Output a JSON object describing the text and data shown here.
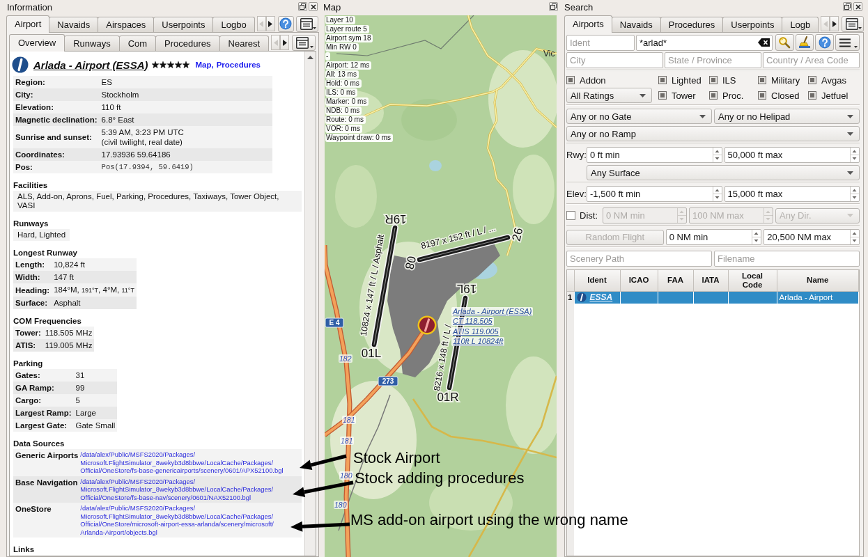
{
  "information": {
    "title": "Information",
    "tabs": [
      {
        "label": "Airport",
        "selected": true
      },
      {
        "label": "Navaids",
        "selected": false
      },
      {
        "label": "Airspaces",
        "selected": false
      },
      {
        "label": "Userpoints",
        "selected": false
      },
      {
        "label": "Logbo",
        "selected": false
      }
    ],
    "tab_scroll": [
      {
        "disabled": true
      },
      {
        "disabled": false
      }
    ],
    "subtabs": [
      {
        "label": "Overview",
        "selected": true
      },
      {
        "label": "Runways",
        "selected": false
      },
      {
        "label": "Com",
        "selected": false
      },
      {
        "label": "Procedures",
        "selected": false
      },
      {
        "label": "Nearest",
        "selected": false
      }
    ],
    "subtab_scroll": [
      {
        "disabled": true
      },
      {
        "disabled": false
      }
    ],
    "airport": {
      "name": "Arlada - Airport (ESSA)",
      "stars": 5,
      "links": [
        "Map",
        "Procedures"
      ],
      "link_separator": ","
    },
    "overview": [
      {
        "label": "Region:",
        "value": "ES",
        "kind": "text"
      },
      {
        "label": "City:",
        "value": "Stockholm",
        "kind": "text"
      },
      {
        "label": "Elevation:",
        "value": "110 ft",
        "kind": "text"
      },
      {
        "label": "Magnetic declination:",
        "value": "6.8° East",
        "kind": "text"
      },
      {
        "label": "Sunrise and sunset:",
        "value": "5:39 AM, 3:23 PM UTC\n(civil twilight, real date)",
        "kind": "text"
      },
      {
        "label": "Coordinates:",
        "value": "17.93936 59.64186",
        "kind": "text"
      },
      {
        "label": "Pos:",
        "value": "Pos(17.9394, 59.6419)",
        "kind": "code"
      }
    ],
    "sections": [
      {
        "heading": "Facilities",
        "kind": "paragraph",
        "text": "ALS, Add-on, Aprons, Fuel, Parking, Procedures, Taxiways, Tower Object, VASI"
      },
      {
        "heading": "Runways",
        "kind": "paragraph",
        "text": "Hard, Lighted"
      },
      {
        "heading": "Longest Runway",
        "kind": "table",
        "rows": [
          {
            "label": "Length:",
            "value": "10,824 ft"
          },
          {
            "label": "Width:",
            "value": "147 ft"
          },
          {
            "label": "Heading:",
            "parts": [
              {
                "text": "184°M, ",
                "kind": "normal"
              },
              {
                "text": "191°T",
                "kind": "small"
              },
              {
                "text": ", 4°M, ",
                "kind": "normal"
              },
              {
                "text": "11°T",
                "kind": "small"
              }
            ]
          },
          {
            "label": "Surface:",
            "value": "Asphalt"
          }
        ]
      },
      {
        "heading": "COM Frequencies",
        "kind": "table",
        "rows": [
          {
            "label": "Tower:",
            "value": "118.505 MHz"
          },
          {
            "label": "ATIS:",
            "value": "119.005 MHz"
          }
        ]
      },
      {
        "heading": "Parking",
        "kind": "table",
        "rows": [
          {
            "label": "Gates:",
            "value": "31"
          },
          {
            "label": "GA Ramp:",
            "value": "99"
          },
          {
            "label": "Cargo:",
            "value": "5"
          },
          {
            "label": "Largest Ramp:",
            "value": "Large"
          },
          {
            "label": "Largest Gate:",
            "value": "Gate Small"
          }
        ]
      },
      {
        "heading": "Data Sources",
        "kind": "sources",
        "rows": [
          {
            "label": "Generic Airports",
            "lines": [
              "/data/alex/Public/MSFS2020/Packages/",
              "Microsoft.FlightSimulator_8wekyb3d8bbwe/LocalCache/Packages/",
              "Official/OneStore/fs-base-genericairports/scenery/0601/APX52100.bgl"
            ]
          },
          {
            "label": "Base Navigation",
            "lines": [
              "/data/alex/Public/MSFS2020/Packages/",
              "Microsoft.FlightSimulator_8wekyb3d8bbwe/LocalCache/Packages/",
              "Official/OneStore/fs-base-nav/scenery/0601/NAX52100.bgl"
            ]
          },
          {
            "label": "OneStore",
            "lines": [
              "/data/alex/Public/MSFS2020/Packages/",
              "Microsoft.FlightSimulator_8wekyb3d8bbwe/LocalCache/Packages/",
              "Official/OneStore/microsoft-airport-essa-arlanda/scenery/microsoft/",
              "Arlanda-Airport/objects.bgl"
            ]
          }
        ]
      },
      {
        "heading": "Links",
        "kind": "heading"
      }
    ]
  },
  "map": {
    "title": "Map",
    "debug_lines": [
      "Layer 10",
      "Layer route 5",
      "Airport sym 18",
      "Min RW 0",
      "-",
      "Airport: 12 ms",
      "All: 13 ms",
      "Hold: 0 ms",
      "ILS: 0 ms",
      "Marker: 0 ms",
      "NDB: 0 ms",
      "Route: 0 ms",
      "VOR: 0 ms",
      "Waypoint draw: 0 ms"
    ],
    "place_labels": [
      "Vic"
    ],
    "runways": [
      {
        "ends": [
          "19R",
          "01L"
        ],
        "label": "10824 x 147 ft / L / Asphalt"
      },
      {
        "ends": [
          "08",
          "26"
        ],
        "label": "8197 x 152 ft / L / ..."
      },
      {
        "ends": [
          "19L",
          "01R"
        ],
        "label": "8216 x 148 ft / L /"
      }
    ],
    "airport_label": [
      "Arlada - Airport (ESSA)",
      "CT 118.505",
      "ATIS 119.005",
      "110ft L 10824ft"
    ],
    "road_shields": [
      "E 4",
      "273"
    ],
    "road_numbers": [
      "182",
      "181",
      "181",
      "180",
      "180"
    ]
  },
  "search": {
    "title": "Search",
    "tabs": [
      {
        "label": "Airports",
        "selected": true
      },
      {
        "label": "Navaids",
        "selected": false
      },
      {
        "label": "Procedures",
        "selected": false
      },
      {
        "label": "Userpoints",
        "selected": false
      },
      {
        "label": "Logb",
        "selected": false
      }
    ],
    "tab_scroll": [
      {
        "disabled": true
      },
      {
        "disabled": false
      }
    ],
    "ident_field": {
      "placeholder": "Ident"
    },
    "name_field": {
      "value": "*arlad*"
    },
    "location_fields": [
      {
        "placeholder": "City"
      },
      {
        "placeholder": "State / Province"
      },
      {
        "placeholder": "Country / Area Code"
      }
    ],
    "rating_combo": {
      "value": "All Ratings"
    },
    "checkboxes": [
      {
        "label": "Addon",
        "partial": true
      },
      {
        "label": "Lighted",
        "partial": true
      },
      {
        "label": "ILS",
        "partial": true
      },
      {
        "label": "Military",
        "partial": true
      },
      {
        "label": "Avgas",
        "partial": true
      },
      {
        "label": "Tower",
        "partial": true
      },
      {
        "label": "Proc.",
        "partial": true
      },
      {
        "label": "Closed",
        "partial": true
      },
      {
        "label": "Jetfuel",
        "partial": true
      }
    ],
    "facility_combos": [
      {
        "value": "Any or no Gate"
      },
      {
        "value": "Any or no Helipad"
      },
      {
        "value": "Any or no Ramp"
      }
    ],
    "runway": {
      "label": "Rwy:",
      "min": "0 ft min",
      "max": "50,000 ft max",
      "surface": "Any Surface"
    },
    "elevation": {
      "label": "Elev:",
      "min": "-1,500 ft min",
      "max": "15,000 ft max"
    },
    "distance": {
      "label": "Dist:",
      "checked": false,
      "disabled": true,
      "min": "0 NM min",
      "max": "100 NM max",
      "direction": "Any Dir."
    },
    "random_flight": {
      "label": "Random Flight",
      "disabled": true,
      "min": "0 NM min",
      "max": "20,500 NM max"
    },
    "path_fields": [
      {
        "placeholder": "Scenery Path"
      },
      {
        "placeholder": "Filename"
      }
    ],
    "table": {
      "columns": [
        "Ident",
        "ICAO",
        "FAA",
        "IATA",
        "Local Code",
        "Name"
      ],
      "rows": [
        {
          "number": "1",
          "ident": "ESSA",
          "name": "Arlada - Airport",
          "selected": true
        }
      ]
    }
  },
  "annotations": [
    {
      "text": "Stock Airport"
    },
    {
      "text": "Stock adding procedures"
    },
    {
      "text": "MS add-on airport using the wrong name"
    }
  ]
}
